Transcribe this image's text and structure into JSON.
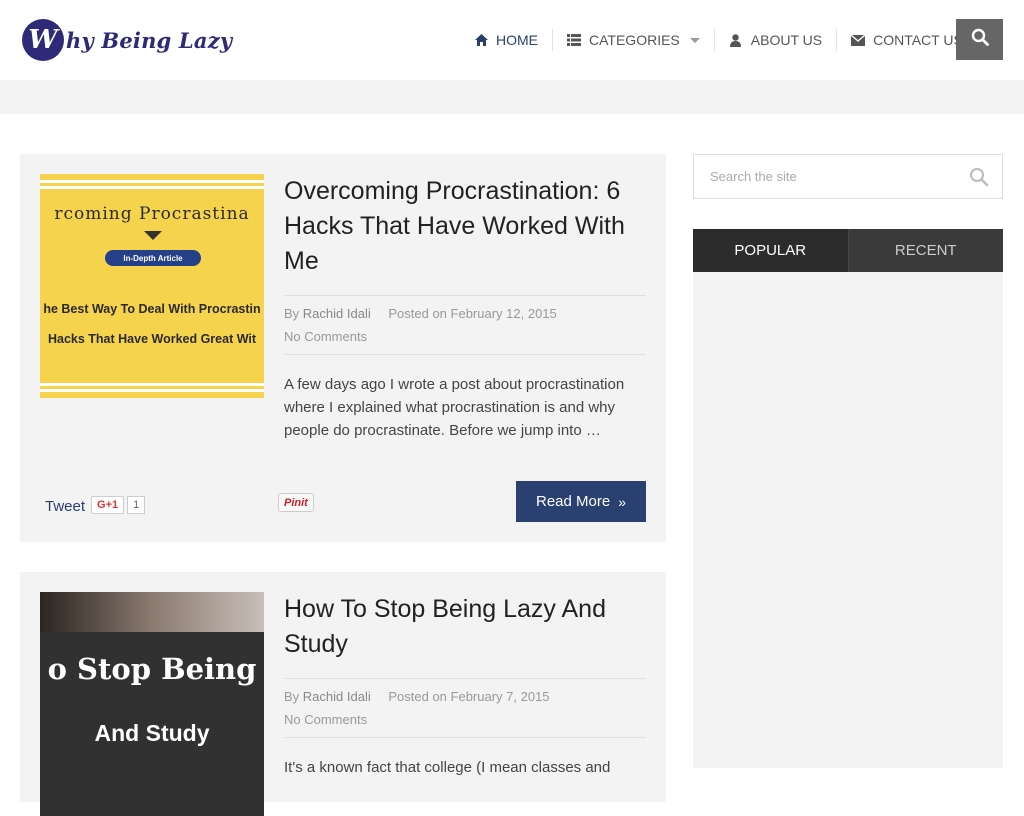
{
  "logo": {
    "initial": "W",
    "text": "hy Being Lazy"
  },
  "nav": {
    "items": [
      {
        "label": "HOME",
        "icon": "home-icon"
      },
      {
        "label": "CATEGORIES",
        "icon": "list-icon"
      },
      {
        "label": "ABOUT US",
        "icon": "user-icon"
      },
      {
        "label": "CONTACT US",
        "icon": "envelope-icon"
      }
    ],
    "search_icon": "search-icon"
  },
  "posts": [
    {
      "title": "Overcoming Procrastination: 6 Hacks That Have Worked With Me",
      "author_prefix": "By",
      "author": "Rachid Idali",
      "date_prefix": "Posted on",
      "date": "February 12, 2015",
      "comments": "No Comments",
      "excerpt": "A few days ago I wrote a post about procrastination where I explained what procrastination is and why people do procrastinate. Before we jump into …",
      "thumb": {
        "heading": "rcoming Procrastina",
        "badge": "In-Depth Article",
        "line1": "he Best Way To Deal With Procrastin",
        "line2": "Hacks That Have Worked Great Wit"
      },
      "share": {
        "tweet": "Tweet",
        "gplus": "G+1",
        "gplus_count": "1",
        "pinit": "Pinit"
      },
      "read_more": "Read More"
    },
    {
      "title": "How To Stop Being Lazy And Study",
      "author_prefix": "By",
      "author": "Rachid Idali",
      "date_prefix": "Posted on",
      "date": "February 7, 2015",
      "comments": "No Comments",
      "excerpt": "It's a known fact that college (I mean classes and",
      "thumb": {
        "line1": "o Stop Being",
        "line2": "And Study"
      }
    }
  ],
  "sidebar": {
    "search_placeholder": "Search the site",
    "tabs": [
      "POPULAR",
      "RECENT"
    ]
  },
  "colors": {
    "brand": "#2e2a78",
    "accent": "#2a4070",
    "panel": "#f3f3f3"
  }
}
